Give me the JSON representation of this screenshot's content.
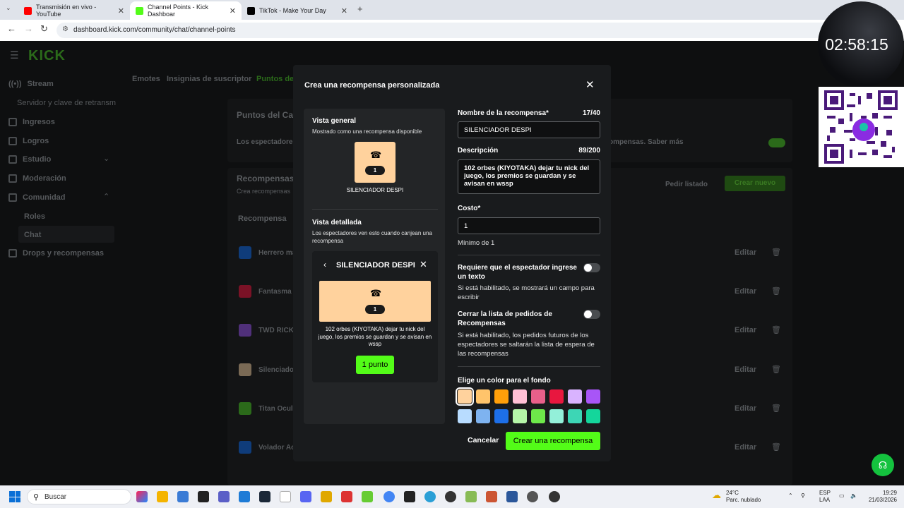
{
  "browser": {
    "tabs": [
      {
        "title": "Transmisión en vivo - YouTube",
        "color": "#ff0000"
      },
      {
        "title": "Channel Points - Kick Dashboar",
        "color": "#53fc18"
      },
      {
        "title": "TikTok - Make Your Day",
        "color": "#000000"
      }
    ],
    "url": "dashboard.kick.com/community/chat/channel-points"
  },
  "sidebar": {
    "logo": "KICK",
    "items": [
      {
        "label": "Stream"
      },
      {
        "label": "Servidor y clave de retransm"
      },
      {
        "label": "Ingresos"
      },
      {
        "label": "Logros"
      },
      {
        "label": "Estudio"
      },
      {
        "label": "Moderación"
      },
      {
        "label": "Comunidad"
      },
      {
        "label": "Roles"
      },
      {
        "label": "Chat"
      },
      {
        "label": "Drops y recompensas"
      }
    ]
  },
  "page": {
    "tabs": [
      "Emotes",
      "Insignias de suscriptor",
      "Puntos de"
    ],
    "points_title": "Puntos del Ca",
    "points_text": "Los espectadores",
    "points_text_right": "ompensas. Saber más",
    "rewards_title": "Recompensas",
    "rewards_subtitle": "Crea recompensas",
    "request_list": "Pedir listado",
    "create_new": "Crear nuevo",
    "col_header": "Recompensa",
    "edit_label": "Editar",
    "rewards": [
      {
        "name": "Herrero ma",
        "color": "#1d6fe8"
      },
      {
        "name": "Fantasma",
        "color": "#e8224a"
      },
      {
        "name": "TWD RICK",
        "color": "#9b5de5"
      },
      {
        "name": "Silenciado",
        "color": "#ffd29d"
      },
      {
        "name": "Titan Ocul",
        "color": "#53fc18"
      },
      {
        "name": "Volador Ac",
        "color": "#1d6fe8"
      }
    ]
  },
  "modal": {
    "title": "Crea una recompensa personalizada",
    "general_title": "Vista general",
    "general_sub": "Mostrado como una recompensa disponible",
    "cost_badge": "1",
    "card_name": "SILENCIADOR DESPI",
    "detail_title": "Vista detallada",
    "detail_sub": "Los espectadores ven esto cuando canjean una recompensa",
    "detail_reward_name": "SILENCIADOR DESPI",
    "detail_desc": "102 orbes (KIYOTAKA)  dejar tu nick del juego, los premios se guardan y se avisan en wssp",
    "detail_button": "1 punto",
    "name_label": "Nombre de la recompensa*",
    "name_count": "17/40",
    "name_value": "SILENCIADOR DESPI",
    "desc_label": "Descripción",
    "desc_count": "89/200",
    "desc_value": "102 orbes (KIYOTAKA)  dejar tu nick del juego, los premios se guardan y se avisan en wssp",
    "cost_label": "Costo*",
    "cost_value": "1",
    "cost_help": "Mínimo de 1",
    "require_text_label": "Requiere que el espectador ingrese un texto",
    "require_text_help": "Si está habilitado, se mostrará un campo para escribir",
    "close_list_label": "Cerrar la lista de pedidos de Recompensas",
    "close_list_help": "Si está habilitado, los pedidos futuros de los espectadores se saltarán la lista de espera de las recompensas",
    "color_label": "Elige un color para el fondo",
    "colors": [
      "#ffd29d",
      "#ffc46b",
      "#ff9f0a",
      "#ffc0d5",
      "#e8608a",
      "#e8173f",
      "#d9b3ff",
      "#a855f7",
      "#b8dcff",
      "#7eb3f0",
      "#1d6fe8",
      "#b6f5a8",
      "#6ee84a",
      "#93f0d9",
      "#3dd6b5",
      "#14d69b"
    ],
    "selected_color": "#ffd29d",
    "cancel": "Cancelar",
    "create": "Crear una recompensa"
  },
  "overlay": {
    "timer": "02:58:15"
  },
  "taskbar": {
    "search": "Buscar",
    "temp": "24°C",
    "weather": "Parc. nublado",
    "lang1": "ESP",
    "lang2": "LAA",
    "time": "19:29",
    "date": "21/03/2026"
  }
}
